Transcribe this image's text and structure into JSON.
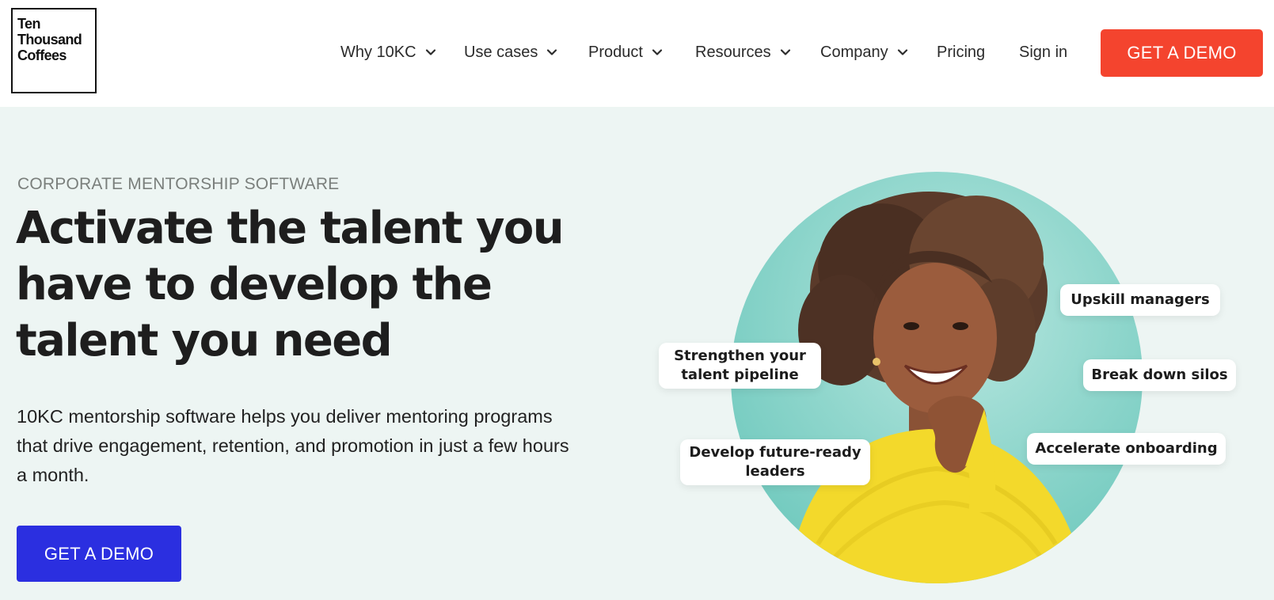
{
  "header": {
    "logo_lines": [
      "Ten",
      "Thousand",
      "Coffees"
    ],
    "nav": [
      {
        "label": "Why 10KC",
        "has_dropdown": true
      },
      {
        "label": "Use cases",
        "has_dropdown": true
      },
      {
        "label": "Product",
        "has_dropdown": true
      },
      {
        "label": "Resources",
        "has_dropdown": true
      },
      {
        "label": "Company",
        "has_dropdown": true
      },
      {
        "label": "Pricing",
        "has_dropdown": false
      },
      {
        "label": "Sign in",
        "has_dropdown": false
      }
    ],
    "cta_label": "GET A DEMO"
  },
  "hero": {
    "eyebrow": "CORPORATE MENTORSHIP SOFTWARE",
    "headline_lines": [
      "Activate the talent you",
      "have to develop the",
      "talent you need"
    ],
    "subtext_lines": [
      "10KC mentorship software helps you deliver mentoring programs",
      "that drive engagement, retention, and promotion in just a few hours",
      "a month."
    ],
    "cta_label": "GET A DEMO"
  },
  "illustration": {
    "tags": [
      {
        "lines": [
          "Upskill managers"
        ]
      },
      {
        "lines": [
          "Strengthen your",
          "talent pipeline"
        ]
      },
      {
        "lines": [
          "Break down silos"
        ]
      },
      {
        "lines": [
          "Develop future-ready",
          "leaders"
        ]
      },
      {
        "lines": [
          "Accelerate onboarding"
        ]
      }
    ]
  },
  "colors": {
    "accent_red": "#f4442e",
    "accent_blue": "#2b2fe0",
    "hero_bg": "#edf5f3",
    "circle_teal": "#8fd6cc"
  },
  "icons": {
    "dropdown": "chevron-down-icon"
  }
}
